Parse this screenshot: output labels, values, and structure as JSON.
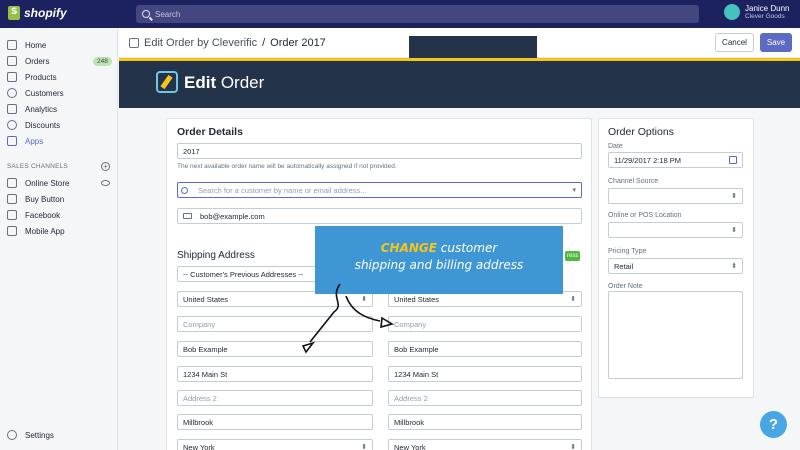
{
  "topbar": {
    "brand": "shopify",
    "search_placeholder": "Search",
    "user_name": "Janice Dunn",
    "user_store": "Clever Goods"
  },
  "sidebar": {
    "items": [
      {
        "label": "Home",
        "icon": "home-icon"
      },
      {
        "label": "Orders",
        "icon": "orders-icon",
        "badge": "248"
      },
      {
        "label": "Products",
        "icon": "tag-icon"
      },
      {
        "label": "Customers",
        "icon": "person-icon"
      },
      {
        "label": "Analytics",
        "icon": "chart-icon"
      },
      {
        "label": "Discounts",
        "icon": "discount-icon"
      },
      {
        "label": "Apps",
        "icon": "apps-icon"
      }
    ],
    "sales_channels_label": "SALES CHANNELS",
    "channels": [
      {
        "label": "Online Store",
        "icon": "store-icon"
      },
      {
        "label": "Buy Button",
        "icon": "buy-button-icon"
      },
      {
        "label": "Facebook",
        "icon": "facebook-icon"
      },
      {
        "label": "Mobile App",
        "icon": "mobile-icon"
      }
    ],
    "settings_label": "Settings"
  },
  "header": {
    "app_name": "Edit Order by Cleverific",
    "separator": "/",
    "page": "Order 2017",
    "cancel_label": "Cancel",
    "save_label": "Save"
  },
  "banner": {
    "title_bold": "Edit",
    "title_rest": " Order"
  },
  "order_details": {
    "title": "Order Details",
    "order_name": "2017",
    "help_text": "The next available order name will be automatically assigned if not provided.",
    "customer_search_placeholder": "Search for a customer by name or email address...",
    "email": "bob@example.com"
  },
  "shipping": {
    "title": "Shipping Address",
    "previous_addresses": "-- Customer's Previous Addresses --",
    "tag_fragment": "ress",
    "left": {
      "country": "United States",
      "company_placeholder": "Company",
      "name": "Bob Example",
      "address1": "1234 Main St",
      "address2_placeholder": "Address 2",
      "city": "Millbrook",
      "state": "New York"
    },
    "right": {
      "country": "United States",
      "company_placeholder": "Company",
      "name": "Bob Example",
      "address1": "1234 Main St",
      "address2_placeholder": "Address 2",
      "city": "Millbrook",
      "state": "New York"
    }
  },
  "order_options": {
    "title": "Order Options",
    "date_label": "Date",
    "date_value": "11/29/2017 2:18 PM",
    "channel_source_label": "Channel Source",
    "location_label": "Online or POS Location",
    "pricing_type_label": "Pricing Type",
    "pricing_type_value": "Retail",
    "order_note_label": "Order Note"
  },
  "callout": {
    "highlight": "CHANGE",
    "line1_rest": " customer",
    "line2": "shipping and billing address"
  },
  "help_button": "?",
  "colors": {
    "topbar": "#1c2260",
    "accent": "#5c6ac4",
    "banner": "#233349",
    "banner_stripe": "#f5c518",
    "callout": "#3e97d4"
  }
}
